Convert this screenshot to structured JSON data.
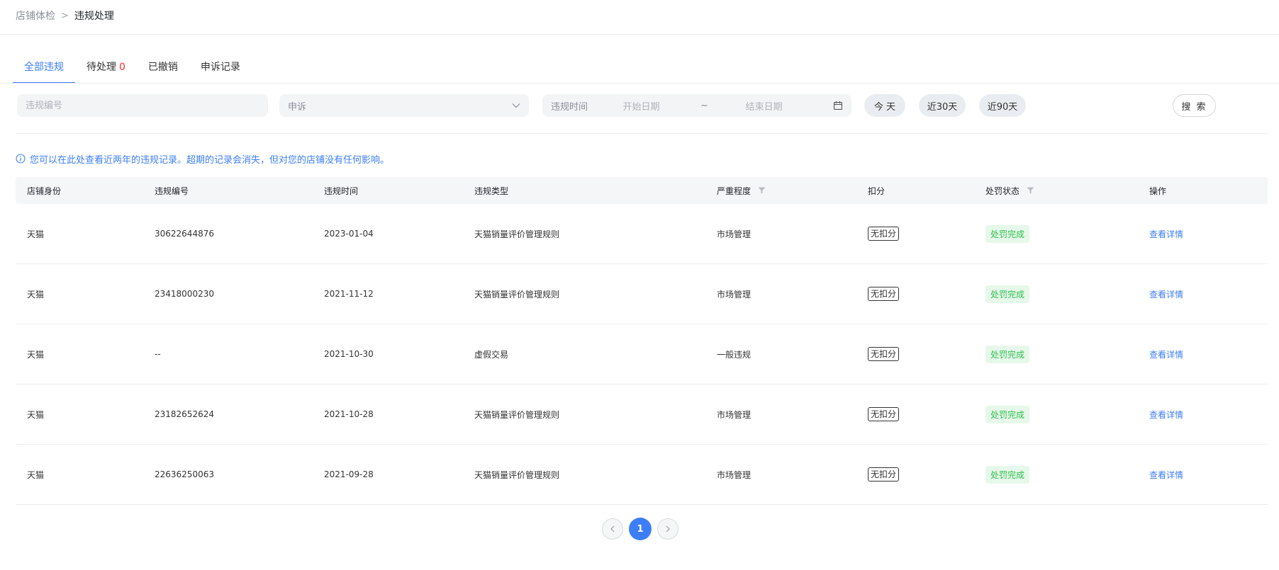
{
  "breadcrumb": {
    "parent": "店铺体检",
    "current": "违规处理"
  },
  "tabs": [
    {
      "label": "全部违规"
    },
    {
      "label": "待处理",
      "count": "0"
    },
    {
      "label": "已撤销"
    },
    {
      "label": "申诉记录"
    }
  ],
  "filters": {
    "violation_no_placeholder": "违规编号",
    "appeal_select": "申诉",
    "date_label": "违规时间",
    "start_placeholder": "开始日期",
    "tilde": "~",
    "end_placeholder": "结束日期",
    "today": "今 天",
    "last30": "近30天",
    "last90": "近90天",
    "search": "搜 索"
  },
  "notice": "您可以在此处查看近两年的违规记录。超期的记录会消失，但对您的店铺没有任何影响。",
  "table": {
    "headers": [
      "店铺身份",
      "违规编号",
      "违规时间",
      "违规类型",
      "严重程度",
      "扣分",
      "处罚状态",
      "操作"
    ],
    "rows": [
      {
        "shop": "天猫",
        "no": "30622644876",
        "time": "2023-01-04",
        "type": "天猫销量评价管理规则",
        "severity": "市场管理",
        "score": "无扣分",
        "status": "处罚完成",
        "action": "查看详情"
      },
      {
        "shop": "天猫",
        "no": "23418000230",
        "time": "2021-11-12",
        "type": "天猫销量评价管理规则",
        "severity": "市场管理",
        "score": "无扣分",
        "status": "处罚完成",
        "action": "查看详情"
      },
      {
        "shop": "天猫",
        "no": "--",
        "time": "2021-10-30",
        "type": "虚假交易",
        "severity": "一般违规",
        "score": "无扣分",
        "status": "处罚完成",
        "action": "查看详情"
      },
      {
        "shop": "天猫",
        "no": "23182652624",
        "time": "2021-10-28",
        "type": "天猫销量评价管理规则",
        "severity": "市场管理",
        "score": "无扣分",
        "status": "处罚完成",
        "action": "查看详情"
      },
      {
        "shop": "天猫",
        "no": "22636250063",
        "time": "2021-09-28",
        "type": "天猫销量评价管理规则",
        "severity": "市场管理",
        "score": "无扣分",
        "status": "处罚完成",
        "action": "查看详情"
      }
    ]
  },
  "pagination": {
    "current_page": "1"
  },
  "colors": {
    "accent": "#3d7ef6",
    "danger": "#ff2b2b",
    "success": "#2fbf4e"
  }
}
